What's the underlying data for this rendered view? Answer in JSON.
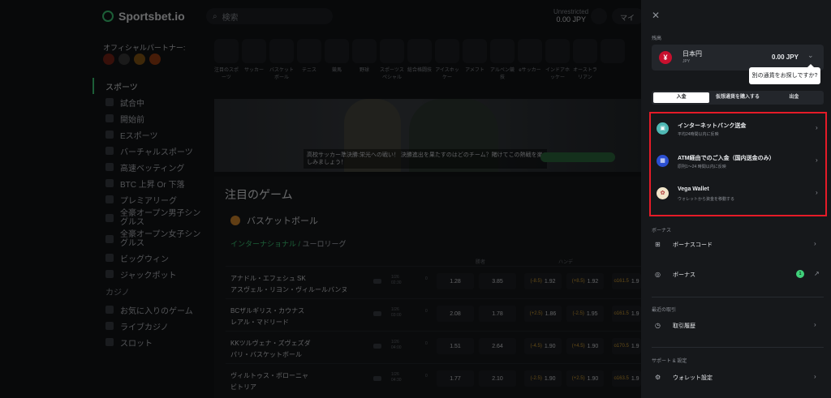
{
  "header": {
    "logo": "Sportsbet.io",
    "search_placeholder": "検索",
    "balance_label": "Unrestricted",
    "balance_amount": "0.00 JPY",
    "account_label": "マイ"
  },
  "partner": {
    "label": "オフィシャルパートナー:"
  },
  "sidebar": {
    "sports_label": "スポーツ",
    "items": [
      {
        "label": "試合中"
      },
      {
        "label": "開始前"
      },
      {
        "label": "Eスポーツ"
      },
      {
        "label": "バーチャルスポーツ"
      },
      {
        "label": "高速ベッティング"
      },
      {
        "label": "BTC 上昇 Or 下落"
      },
      {
        "label": "プレミアリーグ"
      },
      {
        "label": "全豪オープン男子シングルス"
      },
      {
        "label": "全豪オープン女子シングルス"
      },
      {
        "label": "ビッグウィン"
      },
      {
        "label": "ジャックポット"
      }
    ],
    "casino_label": "カジノ",
    "casino_items": [
      {
        "label": "お気に入りのゲーム"
      },
      {
        "label": "ライブカジノ"
      },
      {
        "label": "スロット"
      }
    ]
  },
  "categories": [
    {
      "label": "注目のスポーツ"
    },
    {
      "label": "サッカー"
    },
    {
      "label": "バスケットボール"
    },
    {
      "label": "テニス"
    },
    {
      "label": "競馬"
    },
    {
      "label": "野球"
    },
    {
      "label": "スポーツスペシャル"
    },
    {
      "label": "総合格闘技"
    },
    {
      "label": "アイスホッケー"
    },
    {
      "label": "アメフト"
    },
    {
      "label": "アルペン競技"
    },
    {
      "label": "eサッカー"
    },
    {
      "label": "インドアホッケー"
    },
    {
      "label": "オーストラリアン"
    },
    {
      "label": ""
    }
  ],
  "banner": {
    "caption": "高校サッカー準決勝:栄光への戦い！ 決勝進出を果たすのはどのチーム？賭けてこの熱戦を楽しみましょう！",
    "cta": "ベットする"
  },
  "featured": {
    "title": "注目のゲーム",
    "sport": "バスケットボール",
    "league_region": "インターナショナル",
    "league_name": "ユーロリーグ",
    "col_winner": "勝者",
    "col_handicap": "ハンデ",
    "matches": [
      {
        "home": "アナドル・エフェシュ SK",
        "away": "アスヴェル・リヨン・ヴィルールバンヌ",
        "date": "1/26",
        "time": "02:30",
        "score": "0",
        "o1": "1.28",
        "o2": "3.85",
        "h1": "(-8.5)",
        "h1o": "1.92",
        "h2": "(+8.5)",
        "h2o": "1.92",
        "t": "o161.5",
        "to": "1.9"
      },
      {
        "home": "BCザルギリス・カウナス",
        "away": "レアル・マドリード",
        "date": "1/26",
        "time": "03:00",
        "score": "0",
        "o1": "2.08",
        "o2": "1.78",
        "h1": "(+2.5)",
        "h1o": "1.86",
        "h2": "(-2.5)",
        "h2o": "1.95",
        "t": "o161.5",
        "to": "1.9"
      },
      {
        "home": "KKツルヴェナ・ズヴェズダ",
        "away": "パリ・バスケットボール",
        "date": "1/26",
        "time": "04:00",
        "score": "0",
        "o1": "1.51",
        "o2": "2.64",
        "h1": "(-4.5)",
        "h1o": "1.90",
        "h2": "(+4.5)",
        "h2o": "1.90",
        "t": "o170.5",
        "to": "1.9"
      },
      {
        "home": "ヴィルトゥス・ボローニャ",
        "away": "ビトリア",
        "date": "1/26",
        "time": "04:30",
        "score": "0",
        "o1": "1.77",
        "o2": "2.10",
        "h1": "(-2.5)",
        "h1o": "1.90",
        "h2": "(+2.5)",
        "h2o": "1.90",
        "t": "o163.5",
        "to": "1.9"
      }
    ]
  },
  "drawer": {
    "close": "✕",
    "currency_section": "残高",
    "currency_name": "日本円",
    "currency_code": "JPY",
    "currency_symbol": "¥",
    "currency_amount": "0.00 JPY",
    "tooltip": "別の通貨をお探しですか?",
    "tabs": [
      "入金",
      "仮想通貨を購入する",
      "出金"
    ],
    "methods": [
      {
        "title": "インターネットバンク送金",
        "sub": "平均24時間以内に反映",
        "icon": "bank-icon",
        "color": "#4fb8b4"
      },
      {
        "title": "ATM経由でのご入金（国内送金のみ）",
        "sub": "原則1〜24 時間以内に反映",
        "icon": "atm-icon",
        "color": "#2b4fd1"
      },
      {
        "title": "Vega Wallet",
        "sub": "ウォレットから資金を移動する",
        "icon": "vega-icon",
        "color": "#f1e4c9"
      }
    ],
    "bonus_section": "ボーナス",
    "bonus_code": "ボーナスコード",
    "bonus": "ボーナス",
    "bonus_count": "1",
    "history_section": "最近の取引",
    "history": "取引履歴",
    "settings_section": "サポート & 設定",
    "wallet_settings": "ウォレット設定"
  }
}
